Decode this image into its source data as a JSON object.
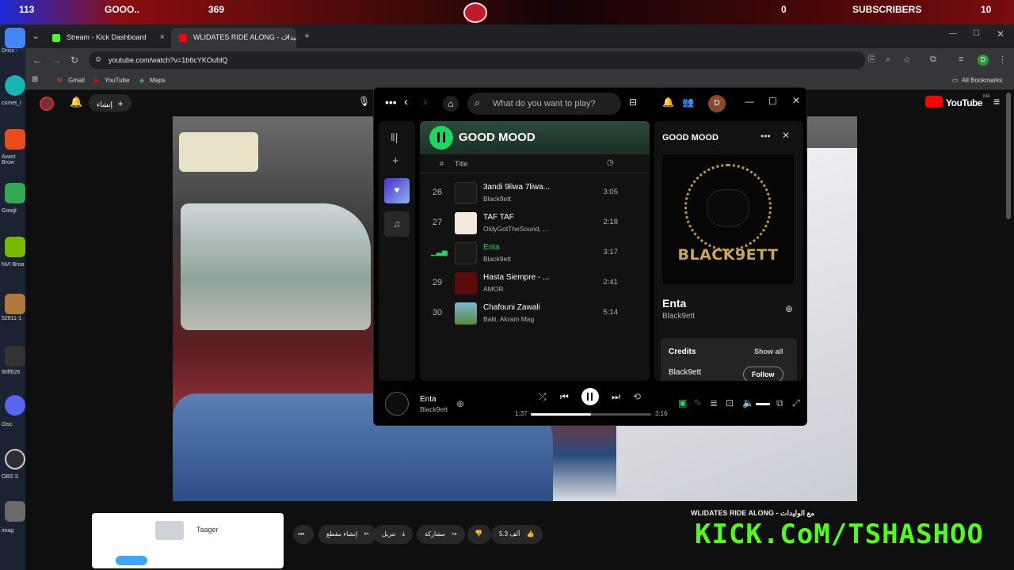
{
  "overlay": {
    "followers": "113",
    "goal": "GOOO..",
    "goal_count": "369",
    "subs_count": "0",
    "subs_label": "SUBSCRIBERS",
    "subs_goal": "10"
  },
  "desktop": {
    "labels": [
      "Driss -",
      "comet_i",
      "Avast Brow",
      "Googl",
      "NVI Broa",
      "52811-1",
      "90ff826",
      "Disc",
      "OBS S",
      "imag"
    ]
  },
  "browser": {
    "tabs": [
      {
        "label": "Stream - Kick Dashboard",
        "color": "#53fc18"
      },
      {
        "label": "WLIDATES RIDE ALONG - ليدات",
        "color": "#ff0000"
      }
    ],
    "url": "youtube.com/watch?v=1b6cYKOufdQ",
    "bookmarks": [
      "Gmail",
      "YouTube",
      "Maps"
    ],
    "all_bookmarks": "All Bookmarks",
    "profile_initial": "D"
  },
  "youtube": {
    "create_label": "إنشاء",
    "logo": "YouTube",
    "logo_region": "MA",
    "video_title": "WLIDATES RIDE ALONG - مع الوليدات",
    "likes": "5.3 ألف",
    "share": "مشاركة",
    "download": "تنزيل",
    "clip": "إنشاء مقطع",
    "more": "•••",
    "ad_brand": "Taager"
  },
  "kick_overlay": "KICK.CoM/TSHASHOO",
  "spotify": {
    "search_placeholder": "What do you want to play?",
    "profile_initial": "D",
    "playlist_name": "GOOD MOOD",
    "col_num": "#",
    "col_title": "Title",
    "tracks": [
      {
        "num": "26",
        "title": "3andi 9liwa 7liwa...",
        "artist": "Black9ett",
        "duration": "3:05",
        "art": "#1a1a1a",
        "active": false
      },
      {
        "num": "27",
        "title": "TAF TAF",
        "artist": "OldyGotTheSound, ...",
        "duration": "2:18",
        "art": "#f2e8dc",
        "active": false
      },
      {
        "num": "",
        "title": "Enta",
        "artist": "Black9ett",
        "duration": "3:17",
        "art": "#1a1a1a",
        "active": true
      },
      {
        "num": "29",
        "title": "Hasta Siempre - ...",
        "artist": "AMOR",
        "duration": "2:41",
        "art": "#5a0b0b",
        "active": false
      },
      {
        "num": "30",
        "title": "Chafouni Zawali",
        "artist": "Balti, Akram Mag",
        "duration": "5:14",
        "art": "#7fb6d6",
        "active": false
      }
    ],
    "now_playing_panel_title": "GOOD MOOD",
    "cover_text": "BLACK9ETT",
    "np_title": "Enta",
    "np_artist": "Black9ett",
    "credits_label": "Credits",
    "show_all": "Show all",
    "credit_artist": "Black9ett",
    "follow": "Follow",
    "bar_title": "Enta",
    "bar_artist": "Black9ett",
    "time_elapsed": "1:37",
    "time_total": "3:16",
    "progress": 0.5,
    "accent": "#1ed760"
  }
}
